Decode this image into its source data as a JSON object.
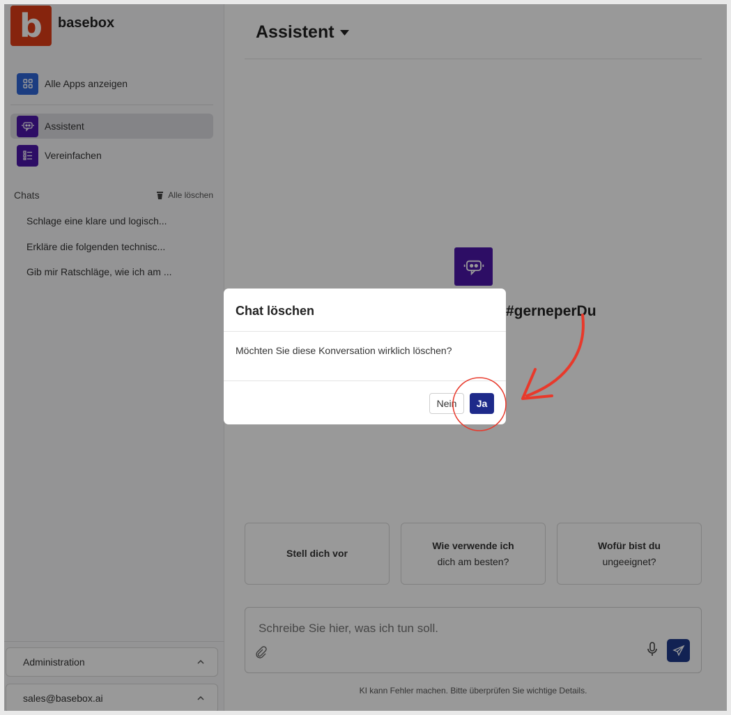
{
  "brand": {
    "logo_letter": "b",
    "name": "basebox"
  },
  "sidebar": {
    "all_apps": "Alle Apps anzeigen",
    "apps": [
      {
        "label": "Assistent",
        "icon": "robot-chat-icon"
      },
      {
        "label": "Vereinfachen",
        "icon": "list-icon"
      }
    ],
    "chats_title": "Chats",
    "clear_all": "Alle löschen",
    "chats": [
      "Schlage eine klare und logisch...",
      "Erkläre die folgenden technisc...",
      "Gib mir Ratschläge, wie ich am ..."
    ],
    "admin": "Administration",
    "account": "sales@basebox.ai"
  },
  "main": {
    "title": "Assistent",
    "hashtag": "#gerneperDu",
    "suggestions": [
      {
        "line1": "Stell dich vor",
        "line2": ""
      },
      {
        "line1": "Wie verwende ich",
        "line2": "dich am besten?"
      },
      {
        "line1": "Wofür bist du",
        "line2": "ungeeignet?"
      }
    ],
    "input_placeholder": "Schreibe Sie hier, was ich tun soll.",
    "footnote": "KI kann Fehler machen. Bitte überprüfen Sie wichtige Details."
  },
  "modal": {
    "title": "Chat löschen",
    "body": "Möchten Sie diese Konversation wirklich löschen?",
    "no": "Nein",
    "yes": "Ja"
  },
  "colors": {
    "brand": "#e03c16",
    "accent": "#1e2a8a",
    "app_icon": "#4b16a9",
    "annotation": "#e8392b"
  }
}
